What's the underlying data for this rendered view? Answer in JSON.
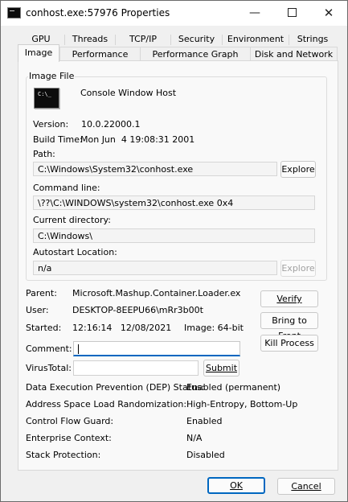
{
  "window": {
    "title": "conhost.exe:57976 Properties",
    "minimize_icon": "minimize-icon",
    "maximize_icon": "maximize-icon",
    "close_icon": "close-icon",
    "minimize_glyph": "—",
    "close_glyph": "✕"
  },
  "tabs": {
    "row1": [
      "GPU Graph",
      "Threads",
      "TCP/IP",
      "Security",
      "Environment",
      "Strings"
    ],
    "row2": [
      "Image",
      "Performance",
      "Performance Graph",
      "Disk and Network"
    ],
    "active": "Image"
  },
  "image_file": {
    "group_title": "Image File",
    "icon_text": "C:\\_",
    "description": "Console Window Host",
    "version_label": "Version:",
    "version_value": "10.0.22000.1",
    "build_label": "Build Time:",
    "build_value": "Mon Jun  4 19:08:31 2001",
    "path_label": "Path:",
    "path_value": "C:\\Windows\\System32\\conhost.exe",
    "explore_label": "Explore",
    "cmdline_label": "Command line:",
    "cmdline_value": "\\??\\C:\\WINDOWS\\system32\\conhost.exe 0x4",
    "curdir_label": "Current directory:",
    "curdir_value": "C:\\Windows\\",
    "autostart_label": "Autostart Location:",
    "autostart_value": "n/a",
    "explore2_label": "Explore"
  },
  "process": {
    "parent_label": "Parent:",
    "parent_value": "Microsoft.Mashup.Container.Loader.ex",
    "user_label": "User:",
    "user_value": "DESKTOP-8EEPU66\\mRr3b00t",
    "started_label": "Started:",
    "started_value": "12:16:14   12/08/2021",
    "image_bits": "Image: 64-bit",
    "comment_label": "Comment:",
    "comment_value": "",
    "virustotal_label": "VirusTotal:",
    "submit_label": "Submit",
    "verify_label": "Verify",
    "bring_label": "Bring to Front",
    "kill_label": "Kill Process"
  },
  "security": [
    {
      "label": "Data Execution Prevention (DEP) Status:",
      "value": "Enabled (permanent)"
    },
    {
      "label": "Address Space Load Randomization:",
      "value": "High-Entropy, Bottom-Up"
    },
    {
      "label": "Control Flow Guard:",
      "value": "Enabled"
    },
    {
      "label": "Enterprise Context:",
      "value": "N/A"
    },
    {
      "label": "Stack Protection:",
      "value": "Disabled"
    }
  ],
  "footer": {
    "ok_label": "OK",
    "cancel_label": "Cancel"
  }
}
